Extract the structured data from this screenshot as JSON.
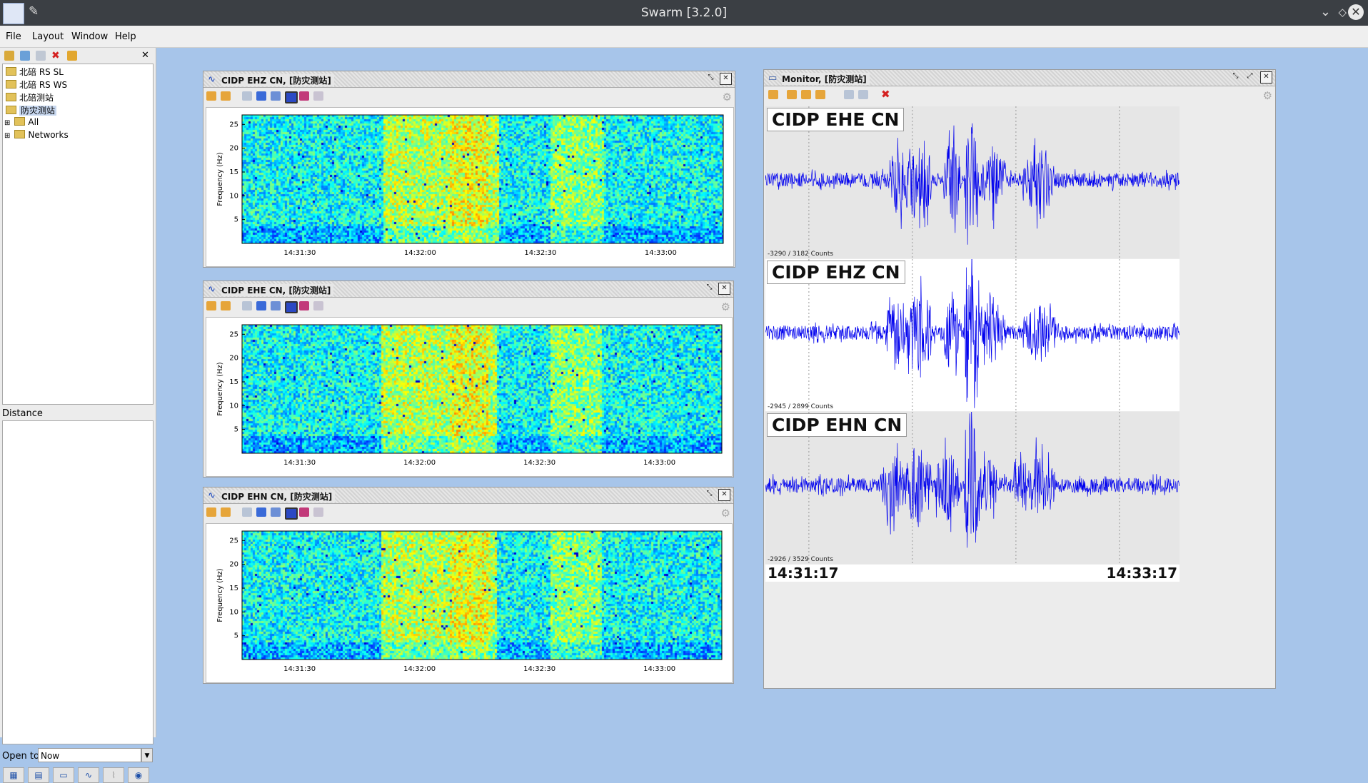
{
  "window": {
    "title": "Swarm [3.2.0]"
  },
  "menu": {
    "file": "File",
    "layout": "Layout",
    "window": "Window",
    "help": "Help"
  },
  "tree": {
    "items": [
      {
        "label": "北碚 RS SL"
      },
      {
        "label": "北碚 RS WS"
      },
      {
        "label": "北碚测站"
      },
      {
        "label": "防灾测站"
      },
      {
        "label": "All"
      },
      {
        "label": "Networks"
      }
    ]
  },
  "distance": {
    "label": "Distance"
  },
  "open_to": {
    "label": "Open to:",
    "value": "Now"
  },
  "spectrograms": [
    {
      "title": "CIDP EHZ CN, [防灾测站]",
      "ylabel": "Frequency (Hz)",
      "yticks": [
        "25",
        "20",
        "15",
        "10",
        "5"
      ],
      "xticks": [
        "14:31:30",
        "14:32:00",
        "14:32:30",
        "14:33:00"
      ]
    },
    {
      "title": "CIDP EHE CN, [防灾测站]",
      "ylabel": "Frequency (Hz)",
      "yticks": [
        "25",
        "20",
        "15",
        "10",
        "5"
      ],
      "xticks": [
        "14:31:30",
        "14:32:00",
        "14:32:30",
        "14:33:00"
      ]
    },
    {
      "title": "CIDP EHN CN, [防灾测站]",
      "ylabel": "Frequency (Hz)",
      "yticks": [
        "25",
        "20",
        "15",
        "10",
        "5"
      ],
      "xticks": [
        "14:31:30",
        "14:32:00",
        "14:32:30",
        "14:33:00"
      ]
    }
  ],
  "monitor": {
    "title": "Monitor, [防灾测站]",
    "channels": [
      {
        "label": "CIDP EHE CN",
        "counts": "-3290 / 3182 Counts"
      },
      {
        "label": "CIDP EHZ CN",
        "counts": "-2945 / 2899 Counts"
      },
      {
        "label": "CIDP EHN CN",
        "counts": "-2926 / 3529 Counts"
      }
    ],
    "start_time": "14:31:17",
    "end_time": "14:33:17"
  },
  "colors": {
    "wave": "#0000ee",
    "background": "#a7c5ea",
    "titlebar": "#3b3f44"
  }
}
